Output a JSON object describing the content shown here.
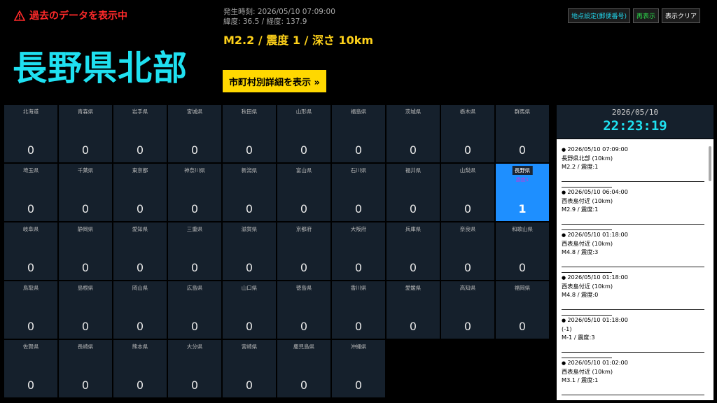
{
  "warning": {
    "text": "過去のデータを表示中",
    "icon": "warning-triangle-icon"
  },
  "region": "長野県北部",
  "meta": {
    "time": "発生時刻: 2026/05/10 07:09:00",
    "coords": "緯度: 36.5 / 経度: 137.9"
  },
  "headline": "M2.2 / 震度 1 / 深さ 10km",
  "detail_button": "市町村別詳細を表示 »",
  "top_buttons": {
    "location": "地点設定(郵便番号)",
    "replay": "再表示",
    "clear": "表示クリア"
  },
  "prefectures": [
    {
      "name": "北海道",
      "count": "0"
    },
    {
      "name": "青森県",
      "count": "0"
    },
    {
      "name": "岩手県",
      "count": "0"
    },
    {
      "name": "宮城県",
      "count": "0"
    },
    {
      "name": "秋田県",
      "count": "0"
    },
    {
      "name": "山形県",
      "count": "0"
    },
    {
      "name": "福島県",
      "count": "0"
    },
    {
      "name": "茨城県",
      "count": "0"
    },
    {
      "name": "栃木県",
      "count": "0"
    },
    {
      "name": "群馬県",
      "count": "0"
    },
    {
      "name": "埼玉県",
      "count": "0"
    },
    {
      "name": "千葉県",
      "count": "0"
    },
    {
      "name": "東京都",
      "count": "0"
    },
    {
      "name": "神奈川県",
      "count": "0"
    },
    {
      "name": "新潟県",
      "count": "0"
    },
    {
      "name": "富山県",
      "count": "0"
    },
    {
      "name": "石川県",
      "count": "0"
    },
    {
      "name": "福井県",
      "count": "0"
    },
    {
      "name": "山梨県",
      "count": "0"
    },
    {
      "name": "長野県",
      "count": "1",
      "active": true,
      "intensity": "震度1"
    },
    {
      "name": "岐阜県",
      "count": "0"
    },
    {
      "name": "静岡県",
      "count": "0"
    },
    {
      "name": "愛知県",
      "count": "0"
    },
    {
      "name": "三重県",
      "count": "0"
    },
    {
      "name": "滋賀県",
      "count": "0"
    },
    {
      "name": "京都府",
      "count": "0"
    },
    {
      "name": "大阪府",
      "count": "0"
    },
    {
      "name": "兵庫県",
      "count": "0"
    },
    {
      "name": "奈良県",
      "count": "0"
    },
    {
      "name": "和歌山県",
      "count": "0"
    },
    {
      "name": "鳥取県",
      "count": "0"
    },
    {
      "name": "島根県",
      "count": "0"
    },
    {
      "name": "岡山県",
      "count": "0"
    },
    {
      "name": "広島県",
      "count": "0"
    },
    {
      "name": "山口県",
      "count": "0"
    },
    {
      "name": "徳島県",
      "count": "0"
    },
    {
      "name": "香川県",
      "count": "0"
    },
    {
      "name": "愛媛県",
      "count": "0"
    },
    {
      "name": "高知県",
      "count": "0"
    },
    {
      "name": "福岡県",
      "count": "0"
    },
    {
      "name": "佐賀県",
      "count": "0"
    },
    {
      "name": "長崎県",
      "count": "0"
    },
    {
      "name": "熊本県",
      "count": "0"
    },
    {
      "name": "大分県",
      "count": "0"
    },
    {
      "name": "宮崎県",
      "count": "0"
    },
    {
      "name": "鹿児島県",
      "count": "0"
    },
    {
      "name": "沖縄県",
      "count": "0"
    }
  ],
  "clock": {
    "date": "2026/05/10",
    "time": "22:23:19"
  },
  "history": [
    {
      "time": "2026/05/10 07:09:00",
      "place": "長野県北部 (10km)",
      "mag": "M2.2 / 震度:1"
    },
    {
      "time": "2026/05/10 06:04:00",
      "place": "西表島付近 (10km)",
      "mag": "M2.9 / 震度:1"
    },
    {
      "time": "2026/05/10 01:18:00",
      "place": "西表島付近 (10km)",
      "mag": "M4.8 / 震度:3"
    },
    {
      "time": "2026/05/10 01:18:00",
      "place": "西表島付近 (10km)",
      "mag": "M4.8 / 震度:0"
    },
    {
      "time": "2026/05/10 01:18:00",
      "place": " (-1)",
      "mag": "M-1 / 震度:3"
    },
    {
      "time": "2026/05/10 01:02:00",
      "place": "西表島付近 (10km)",
      "mag": "M3.1 / 震度:1"
    }
  ],
  "colors": {
    "accent": "#1fe0f0",
    "warning": "#ff2a2a",
    "headline": "#ffd21a",
    "active_cell": "#1e8fff",
    "cell": "#15202c"
  }
}
